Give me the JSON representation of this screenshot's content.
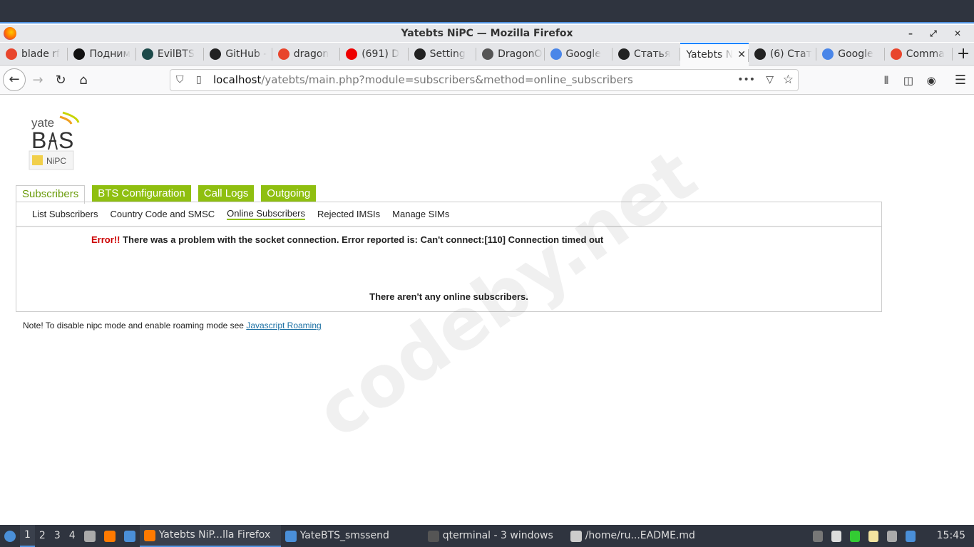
{
  "window": {
    "title": "Yatebts NiPC — Mozilla Firefox",
    "controls": "– ⤢ ✕"
  },
  "tabs": [
    {
      "label": "blade rf",
      "color": "#e8452c"
    },
    {
      "label": "Подним",
      "color": "#111"
    },
    {
      "label": "EvilBTS",
      "color": "#1d4a4a"
    },
    {
      "label": "GitHub -",
      "color": "#222"
    },
    {
      "label": "dragon",
      "color": "#e8452c"
    },
    {
      "label": "(691) D",
      "color": "#e00"
    },
    {
      "label": "Setting",
      "color": "#222"
    },
    {
      "label": "DragonO",
      "color": "#555"
    },
    {
      "label": "Google",
      "color": "#4a86e8"
    },
    {
      "label": "Статья",
      "color": "#222"
    },
    {
      "label": "Yatebts N",
      "color": "",
      "active": true
    },
    {
      "label": "(6) Стат",
      "color": "#222"
    },
    {
      "label": "Google",
      "color": "#4a86e8"
    },
    {
      "label": "Comma",
      "color": "#e8452c"
    }
  ],
  "nav": {
    "url_host": "localhost",
    "url_path": "/yatebts/main.php?module=subscribers&method=online_subscribers"
  },
  "page": {
    "logo": {
      "text1": "yate",
      "text2": "BTS",
      "text3": "NiPC"
    },
    "main_tabs": [
      "Subscribers",
      "BTS Configuration",
      "Call Logs",
      "Outgoing"
    ],
    "sub_tabs": [
      "List Subscribers",
      "Country Code and SMSC",
      "Online Subscribers",
      "Rejected IMSIs",
      "Manage SIMs"
    ],
    "error_label": "Error!!",
    "error_text": "There was a problem with the socket connection. Error reported is: Can't connect:[110] Connection timed out",
    "empty_text": "There aren't any online subscribers.",
    "note_text": "Note! To disable nipc mode and enable roaming mode see ",
    "note_link": "Javascript Roaming",
    "watermark": "codeby.net"
  },
  "taskbar": {
    "workspaces": [
      "1",
      "2",
      "3",
      "4"
    ],
    "windows": [
      "Yatebts NiP...lla Firefox",
      "YateBTS_smssend",
      "qterminal - 3 windows",
      "/home/ru...EADME.md"
    ],
    "clock": "15:45"
  }
}
